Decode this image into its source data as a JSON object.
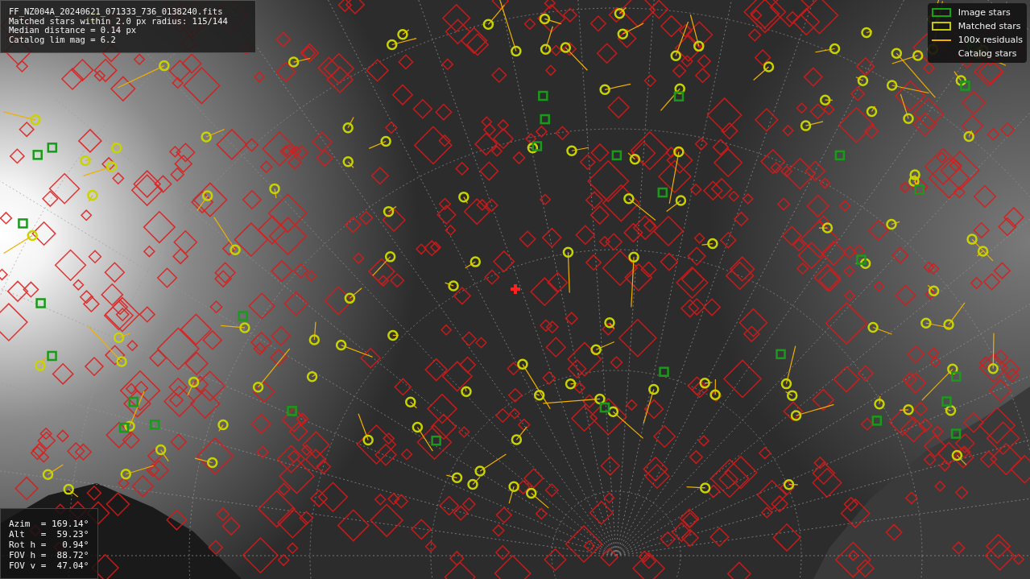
{
  "info_panel": {
    "lines": [
      "FF_NZ004A_20240621_071333_736_0138240.fits",
      "Matched stars within 2.0 px radius: 115/144",
      "Median distance = 0.14 px",
      "Catalog lim mag = 6.2"
    ]
  },
  "legend": {
    "items": [
      {
        "kind": "image",
        "label": "Image stars"
      },
      {
        "kind": "matched",
        "label": "Matched stars"
      },
      {
        "kind": "residual",
        "label": "100x residuals"
      },
      {
        "kind": "catalog",
        "label": "Catalog stars"
      }
    ]
  },
  "pointing_panel": {
    "lines": [
      "Azim  = 169.14°",
      "Alt   =  59.23°",
      "Rot h =   0.94°",
      "FOV h =  88.72°",
      "FOV v =  47.04°"
    ]
  }
}
